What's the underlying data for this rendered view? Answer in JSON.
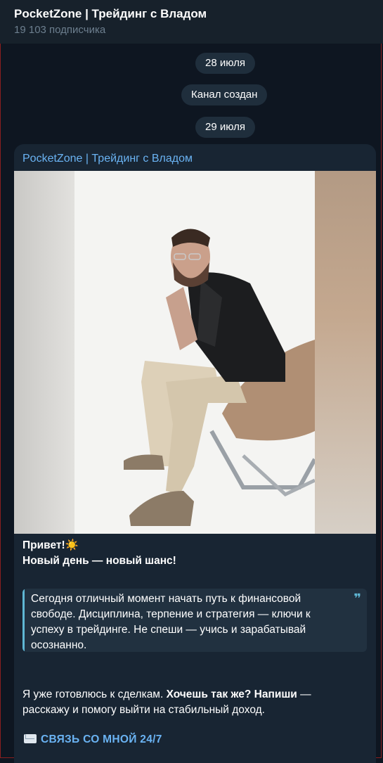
{
  "header": {
    "title": "PocketZone | Трейдинг с Владом",
    "subscribers": "19 103 подписчика"
  },
  "service": {
    "date1": "28 июля",
    "created": "Канал создан",
    "date2": "29 июля"
  },
  "post": {
    "author": "PocketZone | Трейдинг с Владом",
    "greeting": "Привет!",
    "greeting_emoji": "☀️",
    "headline": "Новый день — новый шанс!",
    "quote": "Сегодня отличный момент начать путь к финансовой свободе. Дисциплина, терпение и стратегия — ключи к успеху в трейдинге. Не спеши — учись и зарабатывай осознанно.",
    "quote_icon": "quote-icon",
    "para2_start": "Я уже готовлюсь к сделкам. ",
    "para2_bold": "Хочешь так же? Напиши",
    "para2_end": " — расскажу и помогу выйти на стабильный доход.",
    "contact_link": "СВЯЗЬ СО МНОЙ 24/7"
  },
  "colors": {
    "background": "#0e1621",
    "header": "#17212b",
    "bubble": "#182533",
    "link": "#6ab3f3",
    "quote_accent": "#5fb7d4"
  }
}
